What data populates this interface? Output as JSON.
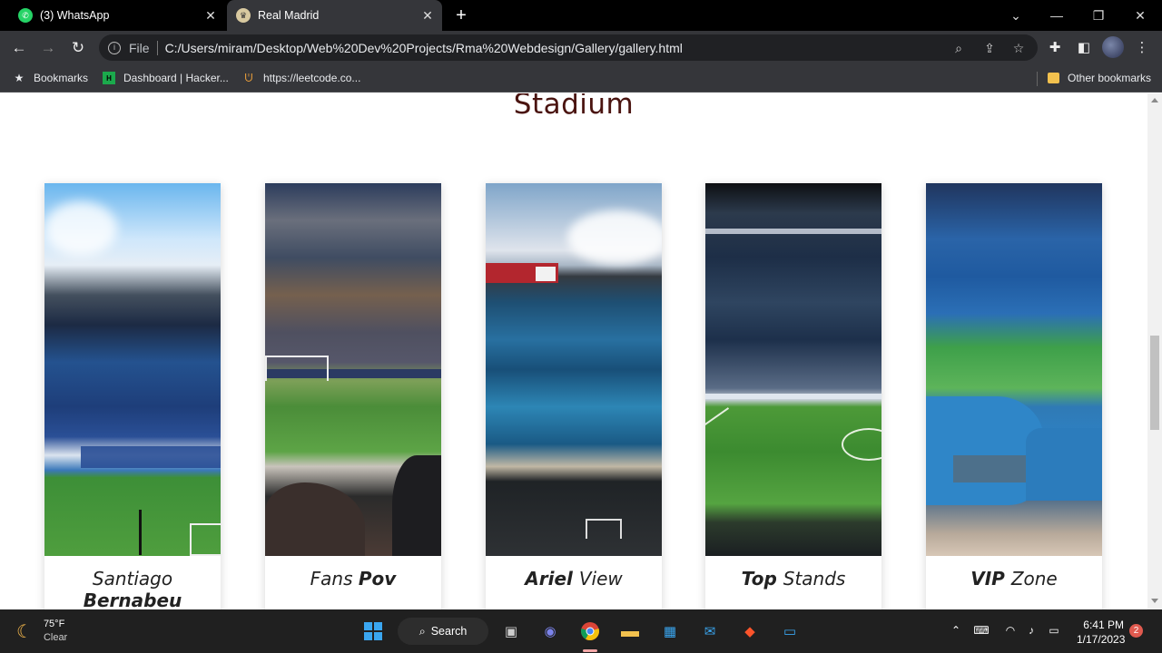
{
  "browser": {
    "tabs": [
      {
        "title": "(3) WhatsApp",
        "favicon": "whatsapp-icon"
      },
      {
        "title": "Real Madrid",
        "favicon": "real-madrid-crest-icon",
        "active": true
      }
    ],
    "address": {
      "scheme_label": "File",
      "url": "C:/Users/miram/Desktop/Web%20Dev%20Projects/Rma%20Webdesign/Gallery/gallery.html"
    },
    "bookmarks": [
      {
        "label": "Bookmarks",
        "icon": "star-icon"
      },
      {
        "label": "Dashboard | Hacker...",
        "icon": "hackerrank-icon"
      },
      {
        "label": "https://leetcode.co...",
        "icon": "leetcode-icon"
      }
    ],
    "other_bookmarks": "Other bookmarks"
  },
  "page": {
    "heading": "Stadium",
    "heading_color": "#4a1410",
    "cards": [
      {
        "caption_parts": [
          {
            "text": "Santiago ",
            "bold": false
          },
          {
            "text": "Bernabeu",
            "bold": true
          }
        ]
      },
      {
        "caption_parts": [
          {
            "text": "Fans ",
            "bold": false
          },
          {
            "text": "Pov",
            "bold": true
          }
        ]
      },
      {
        "caption_parts": [
          {
            "text": "Ariel ",
            "bold": true
          },
          {
            "text": "View",
            "bold": false
          }
        ]
      },
      {
        "caption_parts": [
          {
            "text": "Top ",
            "bold": true
          },
          {
            "text": "Stands",
            "bold": false
          }
        ]
      },
      {
        "caption_parts": [
          {
            "text": "VIP ",
            "bold": true
          },
          {
            "text": "Zone",
            "bold": false
          }
        ]
      }
    ]
  },
  "taskbar": {
    "weather": {
      "temp": "75°F",
      "condition": "Clear",
      "icon": "moon-icon"
    },
    "search_label": "Search",
    "clock": {
      "time": "6:41 PM",
      "date": "1/17/2023"
    },
    "notification_count": "2"
  }
}
